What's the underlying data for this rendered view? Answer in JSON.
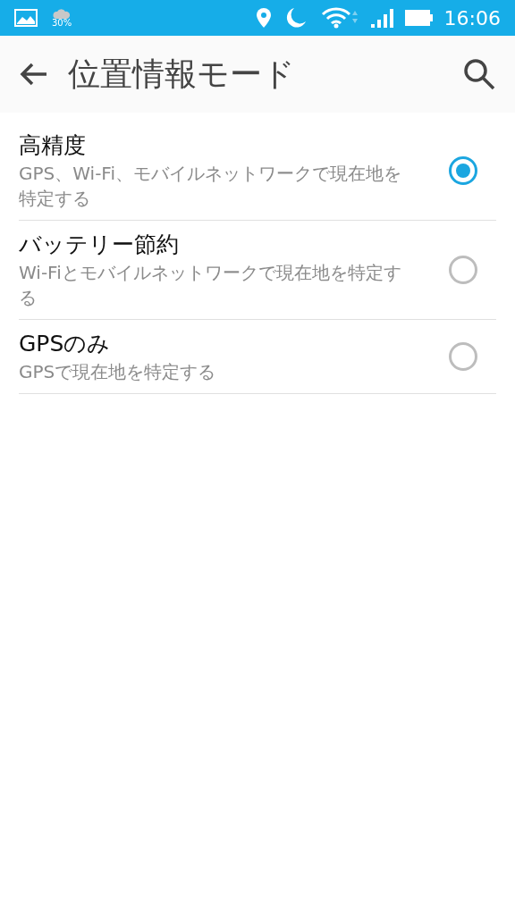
{
  "status_bar": {
    "weather": "30%",
    "time": "16:06"
  },
  "app_bar": {
    "title": "位置情報モード"
  },
  "options": [
    {
      "title": "高精度",
      "description": "GPS、Wi-Fi、モバイルネットワークで現在地を特定する",
      "selected": true
    },
    {
      "title": "バッテリー節約",
      "description": "Wi-Fiとモバイルネットワークで現在地を特定する",
      "selected": false
    },
    {
      "title": "GPSのみ",
      "description": "GPSで現在地を特定する",
      "selected": false
    }
  ]
}
